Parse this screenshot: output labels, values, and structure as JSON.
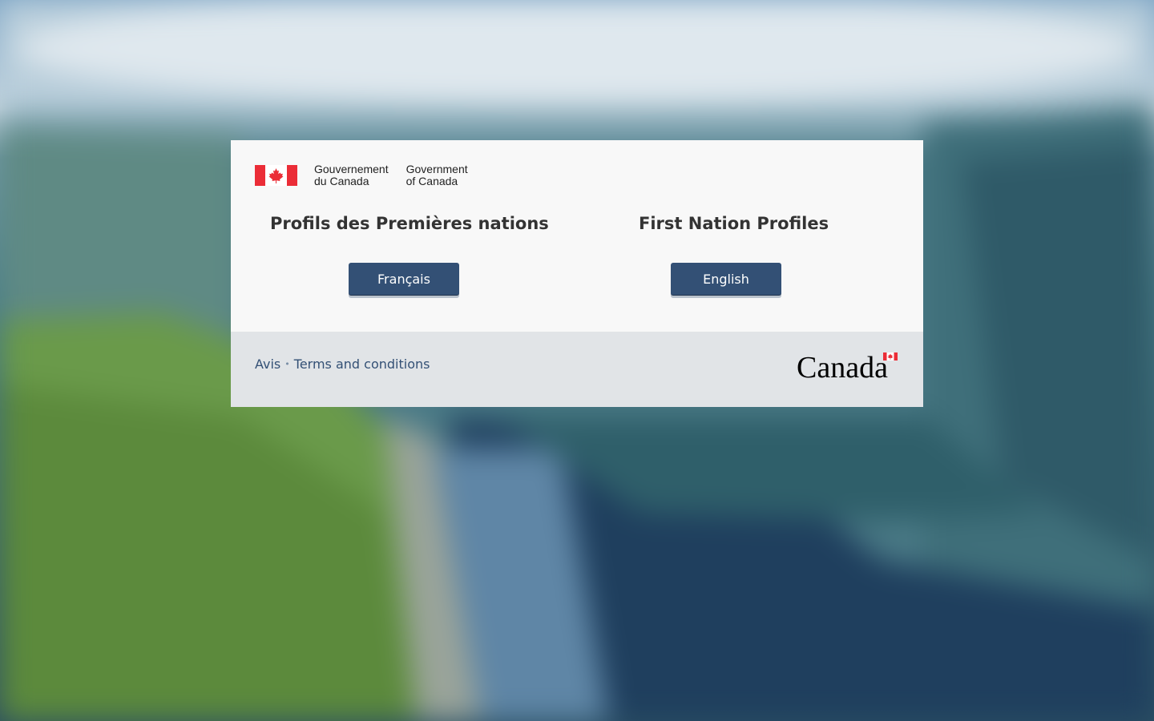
{
  "header": {
    "signature_fr_line1": "Gouvernement",
    "signature_fr_line2": "du Canada",
    "signature_en_line1": "Government",
    "signature_en_line2": "of Canada"
  },
  "titles": {
    "fr": "Profils des Premières nations",
    "en": "First Nation Profiles"
  },
  "buttons": {
    "fr_label": "Français",
    "en_label": "English"
  },
  "footer": {
    "link_notices": "Avis",
    "separator": "•",
    "link_terms": "Terms and conditions",
    "wordmark_text": "Canada"
  },
  "colors": {
    "button": "#335075",
    "flag_red": "#eb2d37",
    "footer_bg": "#e1e4e7",
    "card_bg": "#f8f8f8"
  }
}
